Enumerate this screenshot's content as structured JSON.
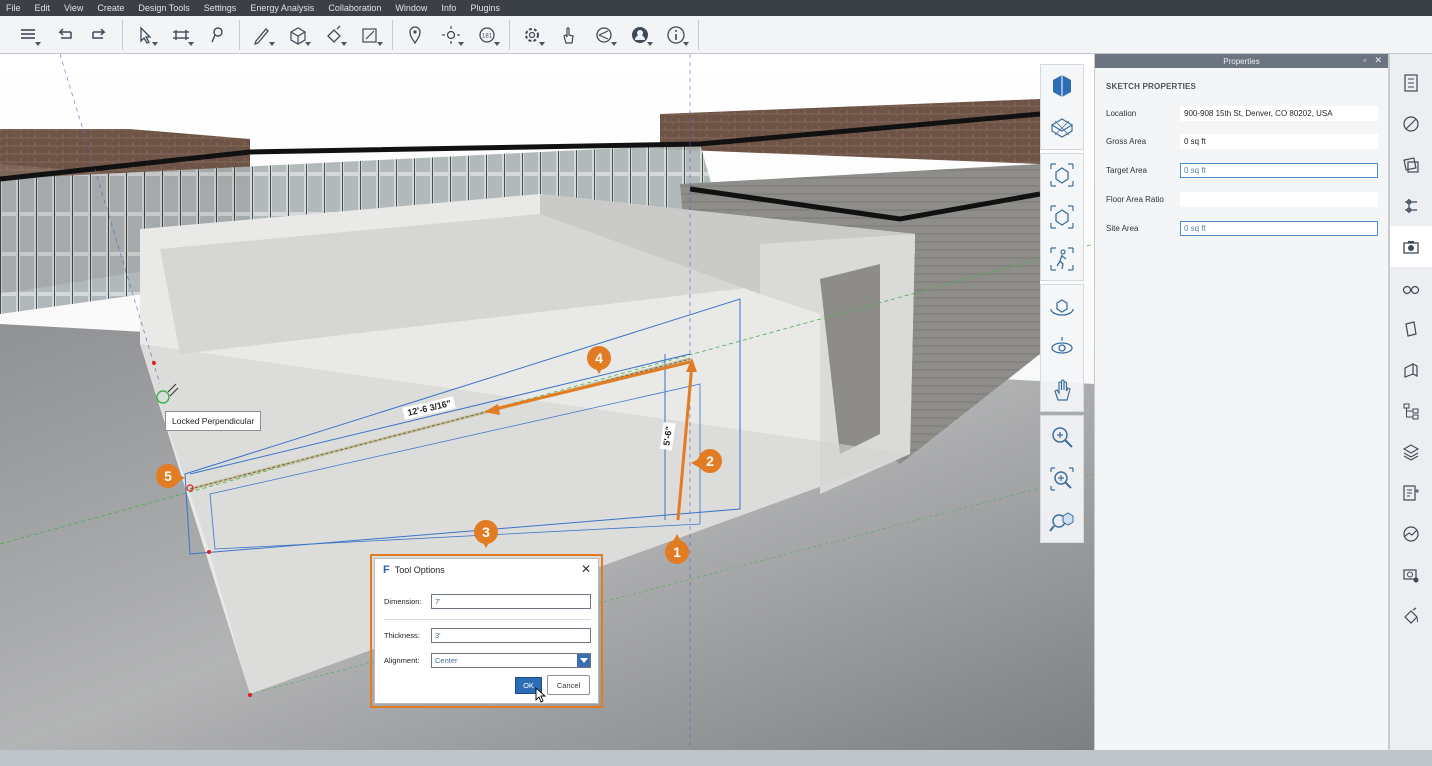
{
  "menu": [
    "File",
    "Edit",
    "View",
    "Create",
    "Design Tools",
    "Settings",
    "Energy Analysis",
    "Collaboration",
    "Window",
    "Info",
    "Plugins"
  ],
  "toolbar_icons": [
    "layers-icon",
    "undo-icon",
    "redo-icon",
    "select-icon",
    "move-icon",
    "inspect-icon",
    "draw-icon",
    "push-pull-icon",
    "paint-icon",
    "section-icon",
    "location-icon",
    "sun-icon",
    "measure-icon",
    "settings-icon",
    "touch-icon",
    "share-icon",
    "account-icon",
    "info-icon"
  ],
  "viewport": {
    "tooltip": "Locked Perpendicular",
    "dim_width": "12'-6 3/16\"",
    "dim_height": "5'-6\"",
    "callouts": [
      "1",
      "2",
      "3",
      "4",
      "5"
    ]
  },
  "dialog": {
    "title": "Tool Options",
    "logo": "F",
    "close": "✕",
    "dimension_label": "Dimension:",
    "dimension_value": "7'",
    "thickness_label": "Thickness:",
    "thickness_value": "3'",
    "alignment_label": "Alignment:",
    "alignment_value": "Center",
    "ok": "OK",
    "cancel": "Cancel"
  },
  "properties": {
    "panel_title": "Properties",
    "controls": [
      "▫",
      "✕"
    ],
    "heading": "SKETCH PROPERTIES",
    "rows": [
      {
        "label": "Location",
        "value": "900-908 15th St, Denver, CO 80202, USA"
      },
      {
        "label": "Gross Area",
        "value": "0 sq ft"
      },
      {
        "label": "Target Area",
        "value": "0 sq ft"
      },
      {
        "label": "Floor Area Ratio",
        "value": ""
      },
      {
        "label": "Site Area",
        "value": "0 sq ft"
      }
    ]
  },
  "nav_icons": [
    "view-cube-icon",
    "home-view-icon",
    "fit-view-icon",
    "perspective-icon",
    "walk-icon",
    "orbit-icon",
    "look-icon",
    "pan-icon",
    "zoom-icon",
    "zoom-window-icon",
    "zoom-extents-icon"
  ],
  "right_strip_icons": [
    "properties-icon",
    "materials-icon",
    "styles-icon",
    "levels-icon",
    "snapshots-icon",
    "view-settings-icon",
    "components-icon",
    "sections-icon",
    "hierarchy-icon",
    "layers-panel-icon",
    "notes-icon",
    "analysis-icon",
    "camera-settings-icon",
    "paint-bucket-icon"
  ],
  "colors": {
    "accent": "#e27b22",
    "dialog_blue": "#2d6db5",
    "dim_line": "#3b73c9"
  }
}
